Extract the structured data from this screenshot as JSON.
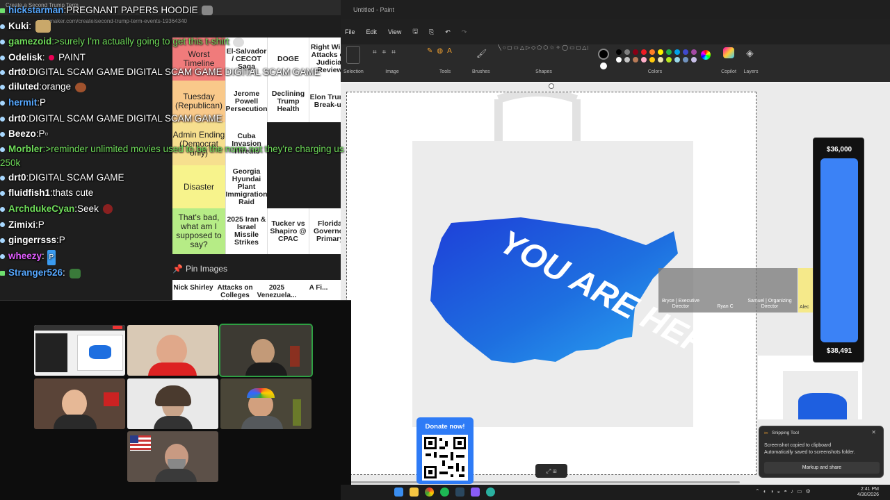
{
  "browser": {
    "tab_title": "Create a Second Trump Term...",
    "url": "tiermaker.com/create/second-trump-term-events-19364340",
    "tiers": [
      {
        "label": "Worst Timeline",
        "color": "#f07b7b",
        "items": [
          "El-Salvador / CECOT Saga",
          "DOGE",
          "Right Wing Attacks on Judicial Review"
        ]
      },
      {
        "label": "Tuesday (Republican)",
        "color": "#f9c98a",
        "items": [
          "Jerome Powell Persecution",
          "Declining Trump Health",
          "Elon Trump Break-up"
        ]
      },
      {
        "label": "Admin Ending (Democrat only)",
        "color": "#f6df8e",
        "items": [
          "Cuba Invasion Threats"
        ]
      },
      {
        "label": "Disaster",
        "color": "#f7f38c",
        "items": [
          "Georgia Hyundai Plant Immigration Raid"
        ]
      },
      {
        "label": "That's bad, what am I supposed to say?",
        "color": "#b6ec86",
        "items": [
          "2025 Iran & Israel Missile Strikes",
          "Tucker vs Shapiro @ CPAC",
          "Florida Governor Primary"
        ]
      }
    ],
    "pin_label": "Pin Images",
    "bottom_items": [
      "Nick Shirley",
      "Attacks on Colleges with Dem...",
      "2025 Venezuela...",
      "A Fi..."
    ]
  },
  "chat": [
    {
      "user": "hickstarman",
      "text": "PREGNANT PAPERS HOODIE",
      "color": "#56a8ff",
      "marker": "x"
    },
    {
      "user": "Kuki",
      "text": "",
      "color": "#ffffff",
      "marker": "dot"
    },
    {
      "user": "gamezoid",
      "text": ">surely I'm actually going to get this t-shirt",
      "color": "#6fdc5a",
      "marker": "dot",
      "green": true
    },
    {
      "user": "Odelisk",
      "text": "PAINT",
      "color": "#ffffff",
      "marker": "dot"
    },
    {
      "user": "drt0",
      "text": "DIGITAL SCAM GAME  DIGITAL SCAM GAME  DIGITAL SCAM GAME",
      "color": "#ffffff",
      "marker": "dot",
      "wrap": true
    },
    {
      "user": "diluted",
      "text": "orange",
      "color": "#ffffff",
      "marker": "dot"
    },
    {
      "user": "hermit",
      "text": "P",
      "color": "#56a8ff",
      "marker": "dot"
    },
    {
      "user": "drt0",
      "text": "DIGITAL SCAM GAME  DIGITAL SCAM GAME",
      "color": "#ffffff",
      "marker": "dot"
    },
    {
      "user": "Beezo",
      "text": "P▫",
      "color": "#ffffff",
      "marker": "dot"
    },
    {
      "user": "Morbler",
      "text": ">reminder unlimited movies used to be the norm  not they're charging us 250k",
      "color": "#6fdc5a",
      "marker": "dot",
      "green": true,
      "wrap": true
    },
    {
      "user": "drt0",
      "text": "DIGITAL SCAM GAME",
      "color": "#ffffff",
      "marker": "dot"
    },
    {
      "user": "fluidfish1",
      "text": "thats cute",
      "color": "#ffffff",
      "marker": "dot"
    },
    {
      "user": "ArchdukeCyan",
      "text": "Seek",
      "color": "#6fdc5a",
      "marker": "dot"
    },
    {
      "user": "Zimixi",
      "text": "P",
      "color": "#ffffff",
      "marker": "dot"
    },
    {
      "user": "gingerrsss",
      "text": "P",
      "color": "#ffffff",
      "marker": "dot"
    },
    {
      "user": "wheezy",
      "text": "P",
      "color": "#e05cff",
      "marker": "dot",
      "pill": true
    },
    {
      "user": "Stranger526",
      "text": "",
      "color": "#56a8ff",
      "marker": "x"
    }
  ],
  "paint": {
    "title": "Untitled - Paint",
    "menu": [
      "File",
      "Edit",
      "View"
    ],
    "groups": [
      "Selection",
      "Image",
      "Tools",
      "Brushes",
      "Shapes",
      "Colors",
      "Copilot",
      "Layers"
    ],
    "colors": [
      "#000000",
      "#7f7f7f",
      "#880015",
      "#ed1c24",
      "#ff7f27",
      "#fff200",
      "#22b14c",
      "#00a2e8",
      "#3f48cc",
      "#a349a4",
      "#ffffff",
      "#c3c3c3",
      "#b97a57",
      "#ffaec9",
      "#ffc90e",
      "#efe4b0",
      "#b5e61d",
      "#99d9ea",
      "#7092be",
      "#c8bfe7"
    ],
    "tote_text": "YOU ARE HERE"
  },
  "donation_goal": {
    "top": "$36,000",
    "bottom": "$38,491",
    "progress": 1.0,
    "color": "#3b82f6"
  },
  "donate_card": {
    "label": "Donate now!"
  },
  "webcam_names": [
    "Bryce | Executive Director",
    "Ryan C",
    "Samuel | Organizing Director",
    "Alec"
  ],
  "toast": {
    "app": "Snipping Tool",
    "message": "Screenshot copied to clipboard",
    "sub": "Automatically saved to screenshots folder.",
    "button": "Markup and share"
  },
  "taskbar": {
    "time": "2:41 PM",
    "date": "4/30/2026"
  }
}
